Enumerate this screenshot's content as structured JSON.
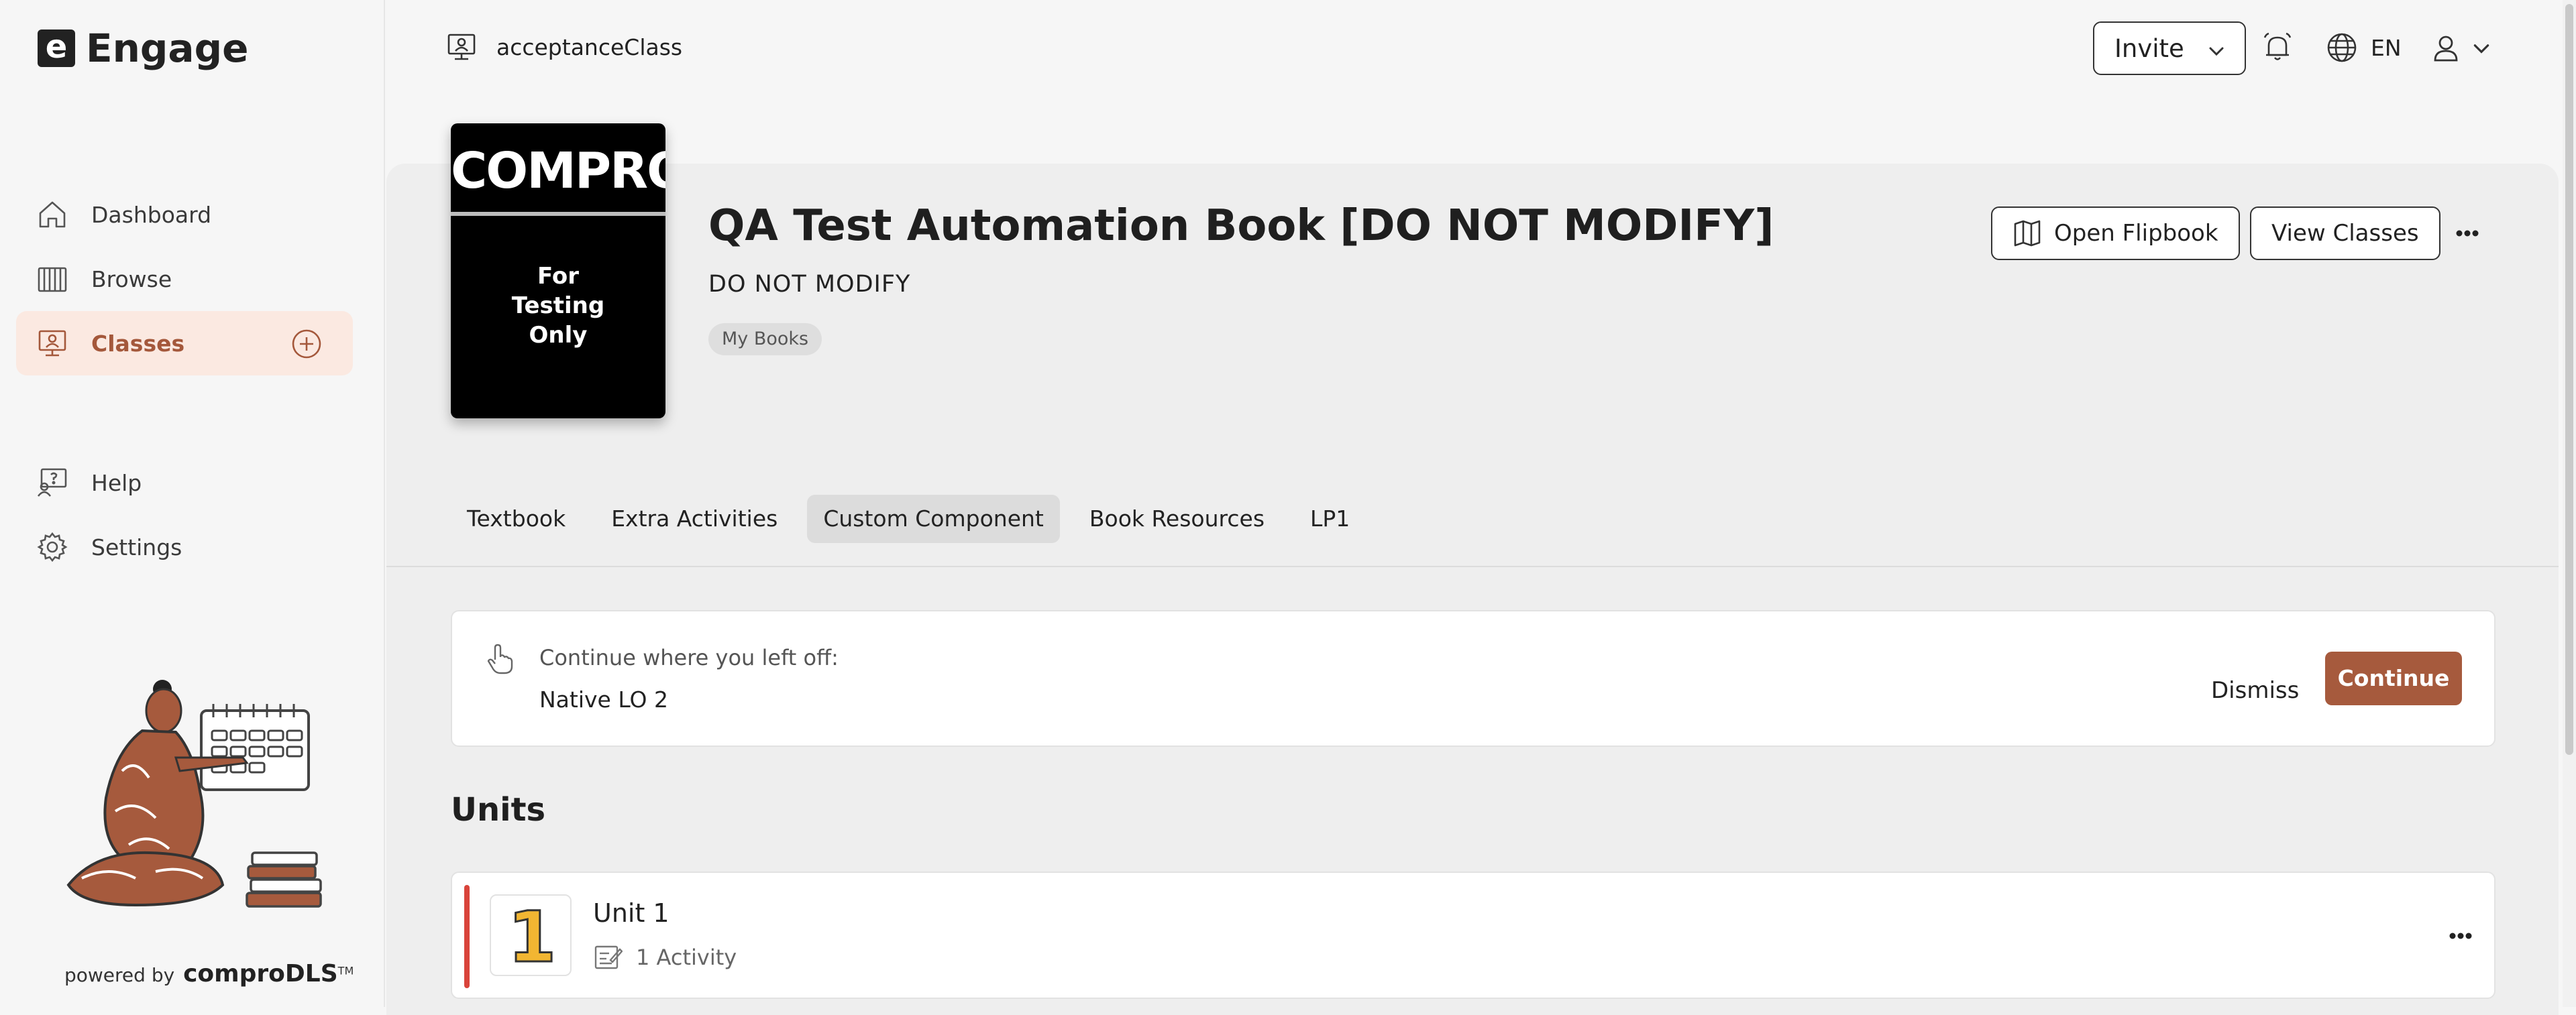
{
  "app": {
    "brand_mark": "e",
    "brand_name": "Engage"
  },
  "sidebar": {
    "items": [
      {
        "label": "Dashboard",
        "icon": "home-icon"
      },
      {
        "label": "Browse",
        "icon": "books-icon"
      },
      {
        "label": "Classes",
        "icon": "classes-icon",
        "active": true
      },
      {
        "label": "Help",
        "icon": "help-icon"
      },
      {
        "label": "Settings",
        "icon": "gear-icon"
      }
    ],
    "powered_by": "powered by",
    "powered_brand": "comproDLS",
    "powered_tm": "TM"
  },
  "topbar": {
    "class_name": "acceptanceClass",
    "invite_label": "Invite",
    "language": "EN"
  },
  "book": {
    "cover_title": "COMPRO",
    "cover_text": "For\nTesting\nOnly",
    "title": "QA Test Automation Book [DO NOT MODIFY]",
    "subtitle": "DO NOT MODIFY",
    "chip": "My Books",
    "open_flipbook_label": "Open Flipbook",
    "view_classes_label": "View Classes"
  },
  "tabs": [
    {
      "label": "Textbook"
    },
    {
      "label": "Extra Activities"
    },
    {
      "label": "Custom Component",
      "active": true
    },
    {
      "label": "Book Resources"
    },
    {
      "label": "LP1"
    }
  ],
  "continue": {
    "caption": "Continue where you left off:",
    "item": "Native LO 2",
    "dismiss_label": "Dismiss",
    "continue_label": "Continue"
  },
  "units": {
    "heading": "Units",
    "items": [
      {
        "number": "1",
        "title": "Unit 1",
        "meta": "1 Activity"
      }
    ]
  },
  "colors": {
    "accent": "#a65a3d",
    "active_nav_bg": "#fbe9e1",
    "unit_marker": "#d9443b",
    "unit_number": "#f2b632"
  }
}
